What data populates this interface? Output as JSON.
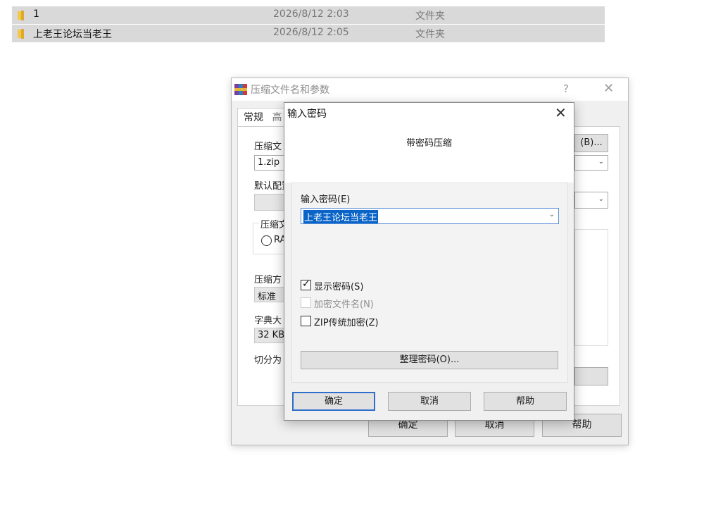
{
  "explorer": {
    "files": [
      {
        "name": "1",
        "date": "2026/8/12 2:03",
        "type": "文件夹"
      },
      {
        "name": "上老王论坛当老王",
        "date": "2026/8/12 2:05",
        "type": "文件夹"
      }
    ]
  },
  "archive_dialog": {
    "title": "压缩文件名和参数",
    "help_glyph": "?",
    "close_glyph": "✕",
    "tab_general": "常规",
    "tab_partial": "高",
    "archive_name_label": "压缩文",
    "archive_name_value": "1.zip",
    "browse_label": "(B)...",
    "default_profile_label": "默认配置",
    "format_group_label": "压缩文",
    "format_option": "RA",
    "method_label": "压缩方",
    "method_value": "标准",
    "dict_label": "字典大",
    "dict_value": "32 KB",
    "split_label": "切分为",
    "ok": "确定",
    "cancel": "取消",
    "help": "帮助"
  },
  "password_dialog": {
    "title": "输入密码",
    "close_glyph": "✕",
    "header": "带密码压缩",
    "password_label": "输入密码(E)",
    "password_value": "上老王论坛当老王",
    "show_password": {
      "label": "显示密码(S)",
      "checked": true,
      "enabled": true
    },
    "encrypt_filenames": {
      "label": "加密文件名(N)",
      "checked": false,
      "enabled": false
    },
    "zip_legacy": {
      "label": "ZIP传统加密(Z)",
      "checked": false,
      "enabled": true
    },
    "organize_button": "整理密码(O)...",
    "ok": "确定",
    "cancel": "取消",
    "help": "帮助"
  },
  "colors": {
    "selection": "#0a64c8",
    "default_button_border": "#2f6ec9",
    "folder_yellow": "#f2c84b"
  }
}
